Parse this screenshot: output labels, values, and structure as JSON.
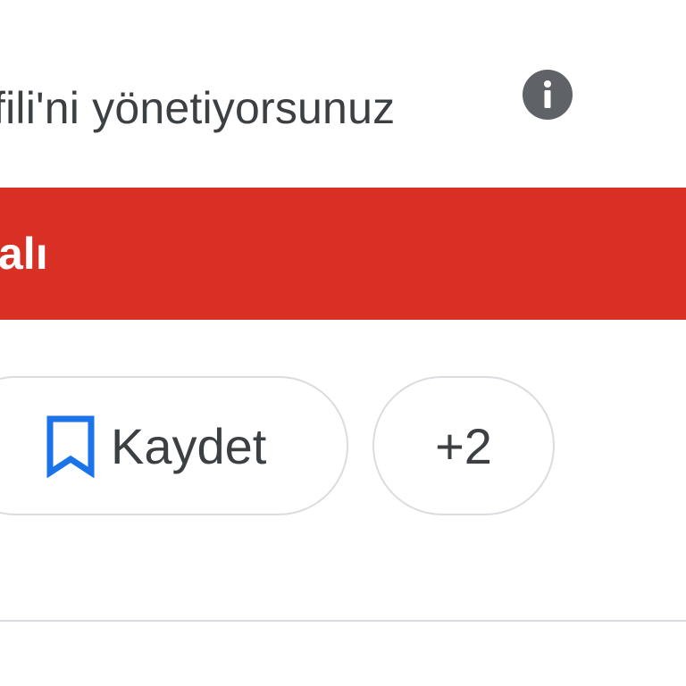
{
  "header": {
    "manage_text": "fili'ni yönetiyorsunuz",
    "info_icon": "info-icon"
  },
  "banner": {
    "text": "alı",
    "color": "#d93025"
  },
  "actions": {
    "save_label": "Kaydet",
    "save_icon": "bookmark-icon",
    "more_label": "+2",
    "accent_color": "#1a73e8"
  }
}
